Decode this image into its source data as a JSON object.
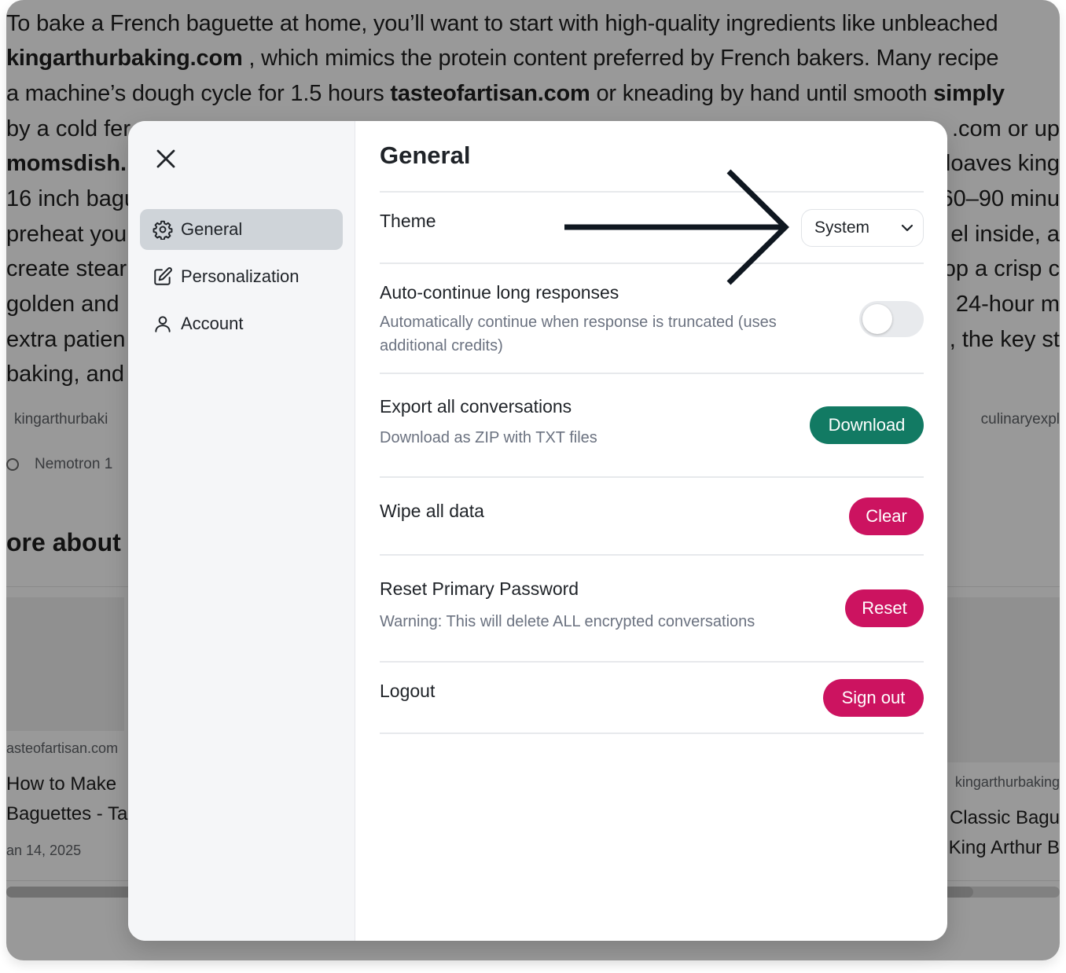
{
  "background": {
    "lines": [
      {
        "parts": [
          {
            "t": "To bake a French baguette at home, you’ll want to start with high-quality ingredients like unbleached",
            "b": false
          }
        ]
      },
      {
        "parts": [
          {
            "t": "kingarthurbaking.com",
            "b": true
          },
          {
            "t": " , which mimics the protein content preferred by French bakers. Many recipe",
            "b": false
          }
        ]
      },
      {
        "parts": [
          {
            "t": "a machine’s dough cycle for 1.5 hours ",
            "b": false
          },
          {
            "t": "tasteofartisan.com",
            "b": true
          },
          {
            "t": " or kneading by hand until smooth ",
            "b": false
          },
          {
            "t": "simply",
            "b": true
          }
        ]
      }
    ],
    "left_fragments": [
      "by a cold fer",
      "momsdish.",
      "16 inch bagu",
      "preheat you",
      "create stear",
      "golden and",
      "extra patien",
      "baking, and"
    ],
    "right_fragments": [
      ".com or up",
      "loaves king",
      "60–90 minu",
      "el inside, a",
      "op a crisp c",
      "24-hour m",
      ", the key st"
    ],
    "source_left": "kingarthurbaki",
    "source_right": "culinaryexpl",
    "model_label": "Nemotron 1",
    "more_heading": "ore about",
    "card_left": {
      "source": "asteofartisan.com",
      "title1": "How to Make",
      "title2": "Baguettes - Ta",
      "date": "an 14, 2025"
    },
    "card_right": {
      "source": "kingarthurbaking",
      "title1": "Classic Bagu",
      "title2": "King Arthur B"
    }
  },
  "modal": {
    "sidebar": {
      "items": [
        {
          "label": "General",
          "icon": "gear-icon",
          "active": true
        },
        {
          "label": "Personalization",
          "icon": "edit-icon",
          "active": false
        },
        {
          "label": "Account",
          "icon": "user-icon",
          "active": false
        }
      ]
    },
    "title": "General",
    "theme": {
      "label": "Theme",
      "value": "System"
    },
    "auto_continue": {
      "label": "Auto-continue long responses",
      "desc_line1": "Automatically continue when response is truncated (uses",
      "desc_line2": "additional credits)",
      "enabled": false
    },
    "export": {
      "label": "Export all conversations",
      "desc": "Download as ZIP with TXT files",
      "button": "Download"
    },
    "wipe": {
      "label": "Wipe all data",
      "button": "Clear"
    },
    "reset": {
      "label": "Reset Primary Password",
      "desc": "Warning: This will delete ALL encrypted conversations",
      "button": "Reset"
    },
    "logout": {
      "label": "Logout",
      "button": "Sign out"
    }
  },
  "colors": {
    "primary_green": "#127a63",
    "danger_pink": "#cc1360",
    "sidebar_active": "#cfd4d9"
  }
}
